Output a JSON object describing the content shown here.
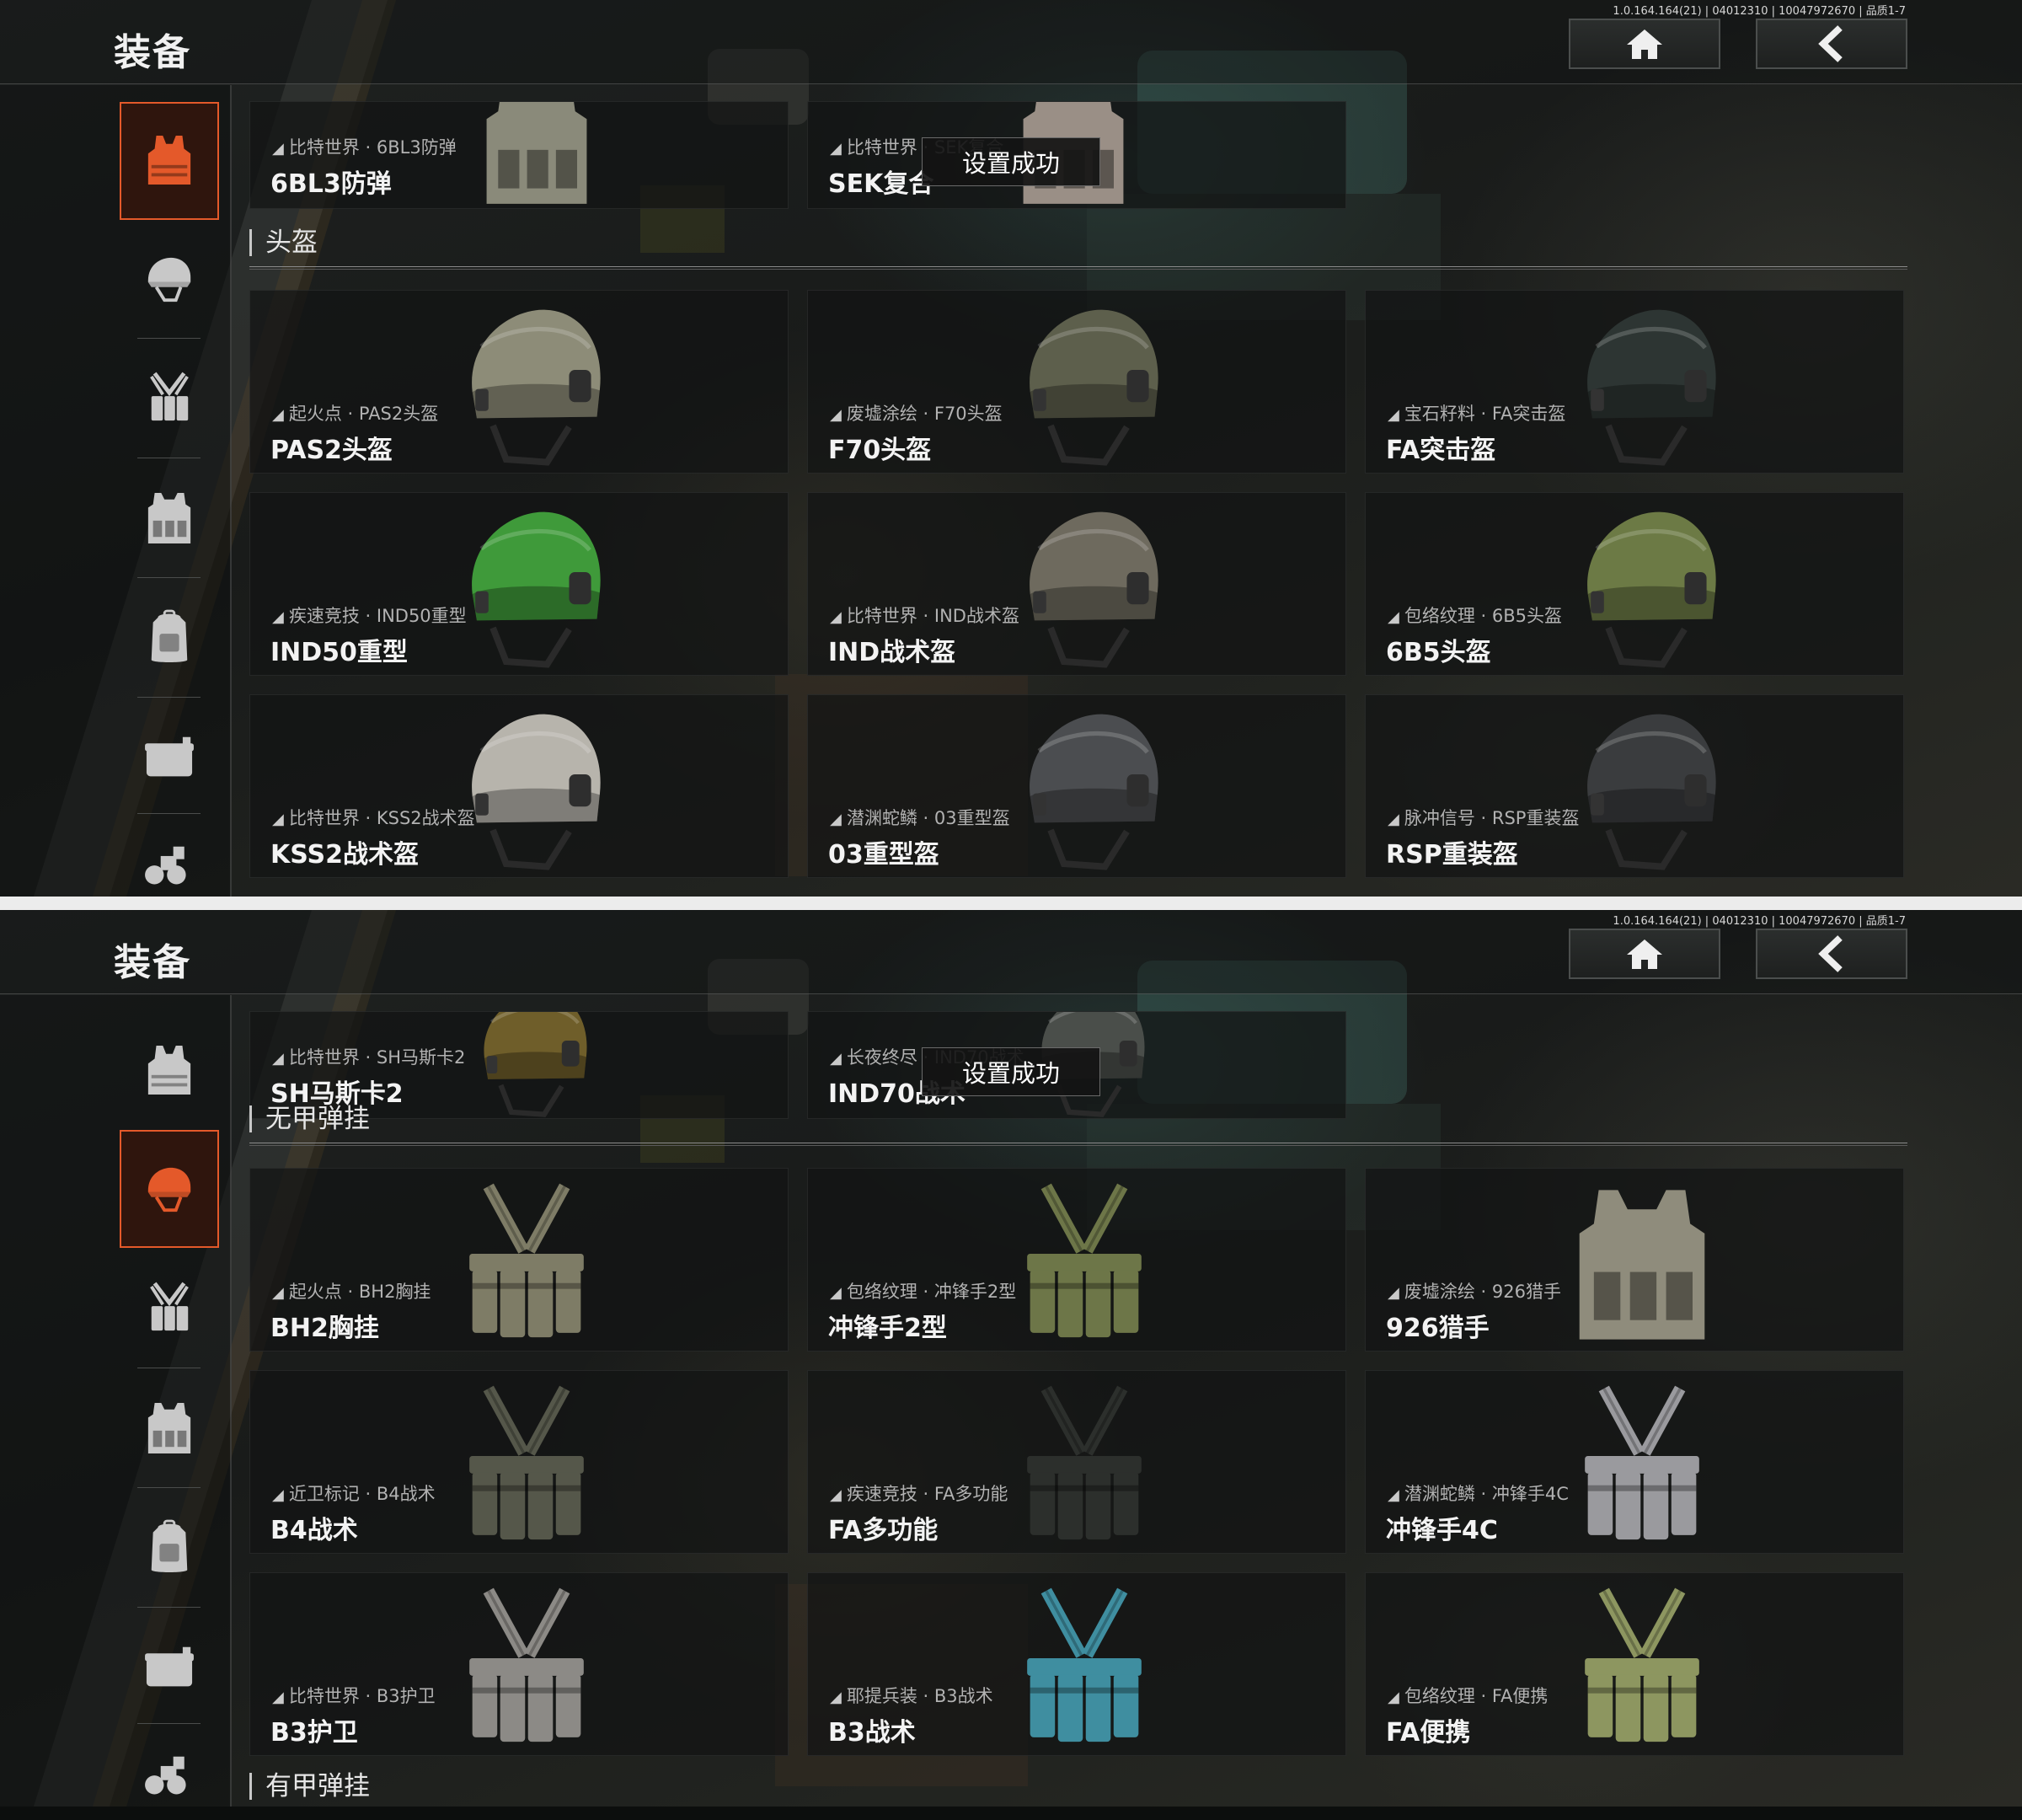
{
  "screen1": {
    "title": "装备",
    "version": "1.0.164.164(21) | 04012310 | 10047972670 | 品质1-7",
    "toast": "设置成功",
    "section": "头盔",
    "partial": [
      {
        "sub": "比特世界 · 6BL3防弹",
        "name": "6BL3防弹"
      },
      {
        "sub": "比特世界 · SEK复合",
        "name": "SEK复合"
      }
    ],
    "items": [
      {
        "sub": "起火点 · PAS2头盔",
        "name": "PAS2头盔"
      },
      {
        "sub": "废墟涂绘 · F70头盔",
        "name": "F70头盔"
      },
      {
        "sub": "宝石籽料 · FA突击盔",
        "name": "FA突击盔"
      },
      {
        "sub": "疾速竞技 · IND50重型",
        "name": "IND50重型"
      },
      {
        "sub": "比特世界 · IND战术盔",
        "name": "IND战术盔"
      },
      {
        "sub": "包络纹理 · 6B5头盔",
        "name": "6B5头盔"
      },
      {
        "sub": "比特世界 · KSS2战术盔",
        "name": "KSS2战术盔"
      },
      {
        "sub": "潜渊蛇鳞 · 03重型盔",
        "name": "03重型盔"
      },
      {
        "sub": "脉冲信号 · RSP重装盔",
        "name": "RSP重装盔"
      }
    ]
  },
  "screen2": {
    "title": "装备",
    "version": "1.0.164.164(21) | 04012310 | 10047972670 | 品质1-7",
    "toast": "设置成功",
    "section": "无甲弹挂",
    "section_next": "有甲弹挂",
    "partial": [
      {
        "sub": "比特世界 · SH马斯卡2",
        "name": "SH马斯卡2"
      },
      {
        "sub": "长夜终尽 · IND70战术",
        "name": "IND70战术"
      }
    ],
    "items": [
      {
        "sub": "起火点 · BH2胸挂",
        "name": "BH2胸挂"
      },
      {
        "sub": "包络纹理 · 冲锋手2型",
        "name": "冲锋手2型"
      },
      {
        "sub": "废墟涂绘 · 926猎手",
        "name": "926猎手"
      },
      {
        "sub": "近卫标记 · B4战术",
        "name": "B4战术"
      },
      {
        "sub": "疾速竞技 · FA多功能",
        "name": "FA多功能"
      },
      {
        "sub": "潜渊蛇鳞 · 冲锋手4C",
        "name": "冲锋手4C"
      },
      {
        "sub": "比特世界 · B3护卫",
        "name": "B3护卫"
      },
      {
        "sub": "耶提兵装 · B3战术",
        "name": "B3战术"
      },
      {
        "sub": "包络纹理 · FA便携",
        "name": "FA便携"
      }
    ]
  },
  "icons": {
    "home": "home-icon",
    "back": "chevron-left-icon",
    "categories": [
      "body-armor-icon",
      "helmet-icon",
      "chest-rig-icon",
      "armored-rig-icon",
      "backpack-icon",
      "pouch-icon",
      "night-vision-icon"
    ]
  },
  "colors": {
    "accent": "#e4592a",
    "active_bg": "#2f150d",
    "text": "#f3f3f3",
    "subtext": "#b2b2b2"
  }
}
